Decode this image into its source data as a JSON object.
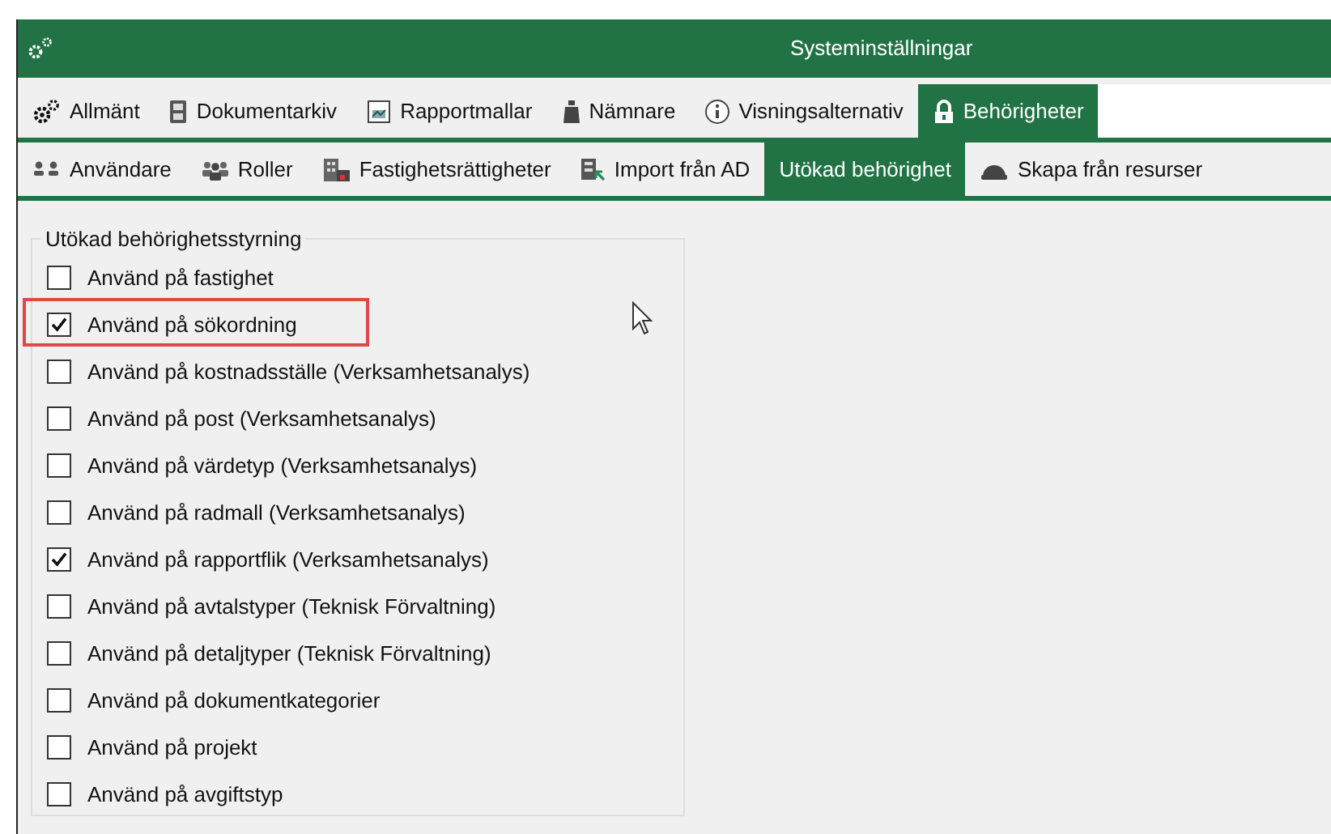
{
  "window": {
    "title": "Systeminställningar"
  },
  "tabs": [
    {
      "label": "Allmänt",
      "selected": false
    },
    {
      "label": "Dokumentarkiv",
      "selected": false
    },
    {
      "label": "Rapportmallar",
      "selected": false
    },
    {
      "label": "Nämnare",
      "selected": false
    },
    {
      "label": "Visningsalternativ",
      "selected": false
    },
    {
      "label": "Behörigheter",
      "selected": true
    }
  ],
  "subtabs": [
    {
      "label": "Användare",
      "selected": false
    },
    {
      "label": "Roller",
      "selected": false
    },
    {
      "label": "Fastighetsrättigheter",
      "selected": false
    },
    {
      "label": "Import från AD",
      "selected": false
    },
    {
      "label": "Utökad behörighet",
      "selected": true
    },
    {
      "label": "Skapa från resurser",
      "selected": false
    }
  ],
  "group": {
    "title": "Utökad behörighetsstyrning",
    "items": [
      {
        "label": "Använd på fastighet",
        "checked": false,
        "highlighted": false
      },
      {
        "label": "Använd på sökordning",
        "checked": true,
        "highlighted": true
      },
      {
        "label": "Använd på kostnadsställe (Verksamhetsanalys)",
        "checked": false,
        "highlighted": false
      },
      {
        "label": "Använd på post (Verksamhetsanalys)",
        "checked": false,
        "highlighted": false
      },
      {
        "label": "Använd på värdetyp (Verksamhetsanalys)",
        "checked": false,
        "highlighted": false
      },
      {
        "label": "Använd på radmall (Verksamhetsanalys)",
        "checked": false,
        "highlighted": false
      },
      {
        "label": "Använd på rapportflik (Verksamhetsanalys)",
        "checked": true,
        "highlighted": false
      },
      {
        "label": "Använd på avtalstyper (Teknisk Förvaltning)",
        "checked": false,
        "highlighted": false
      },
      {
        "label": "Använd på detaljtyper (Teknisk Förvaltning)",
        "checked": false,
        "highlighted": false
      },
      {
        "label": "Använd på dokumentkategorier",
        "checked": false,
        "highlighted": false
      },
      {
        "label": "Använd på projekt",
        "checked": false,
        "highlighted": false
      },
      {
        "label": "Använd på avgiftstyp",
        "checked": false,
        "highlighted": false
      }
    ]
  }
}
